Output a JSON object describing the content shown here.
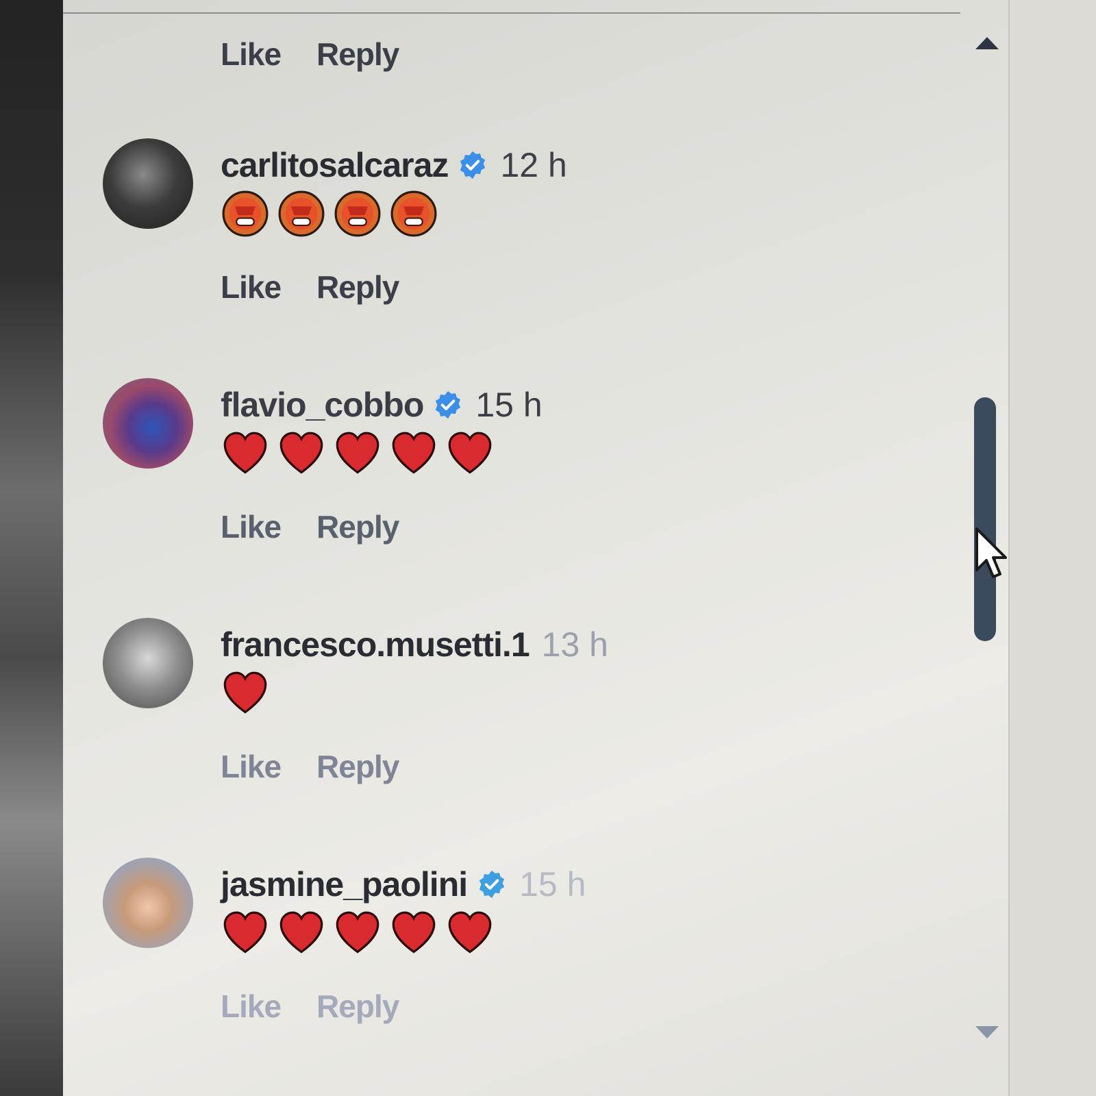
{
  "top_actions": {
    "like": "Like",
    "reply": "Reply"
  },
  "comments": [
    {
      "username": "carlitosalcaraz",
      "verified": true,
      "time": "12 h",
      "reaction_icon": "star-struck-face-emoji",
      "reaction_count": 4,
      "like": "Like",
      "reply": "Reply"
    },
    {
      "username": "flavio_cobbo",
      "verified": true,
      "time": "15 h",
      "reaction_icon": "red-heart-emoji",
      "reaction_count": 5,
      "like": "Like",
      "reply": "Reply"
    },
    {
      "username": "francesco.musetti.1",
      "verified": false,
      "time": "13 h",
      "reaction_icon": "red-heart-emoji",
      "reaction_count": 1,
      "like": "Like",
      "reply": "Reply"
    },
    {
      "username": "jasmine_paolini",
      "verified": true,
      "time": "15 h",
      "reaction_icon": "red-heart-emoji",
      "reaction_count": 5,
      "like": "Like",
      "reply": "Reply"
    }
  ],
  "colors": {
    "verified": "#3d8ee8",
    "heart": "#d92a2f",
    "text": "#2a2c33"
  }
}
